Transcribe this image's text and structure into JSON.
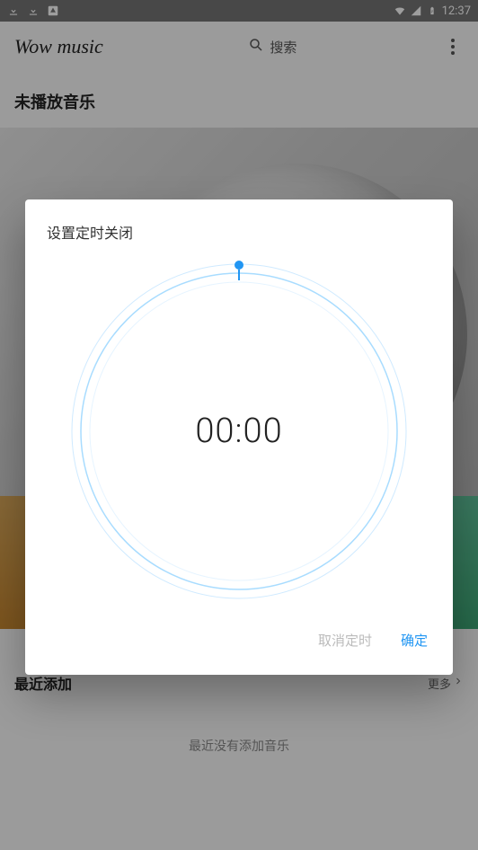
{
  "status": {
    "time": "12:37"
  },
  "app": {
    "title": "Wow music",
    "search_label": "搜索"
  },
  "main": {
    "now_playing_heading": "未播放音乐",
    "recent_heading": "最近添加",
    "more_label": "更多",
    "recent_empty": "最近没有添加音乐"
  },
  "dialog": {
    "title": "设置定时关闭",
    "time_value": "00:00",
    "cancel_label": "取消定时",
    "confirm_label": "确定"
  }
}
